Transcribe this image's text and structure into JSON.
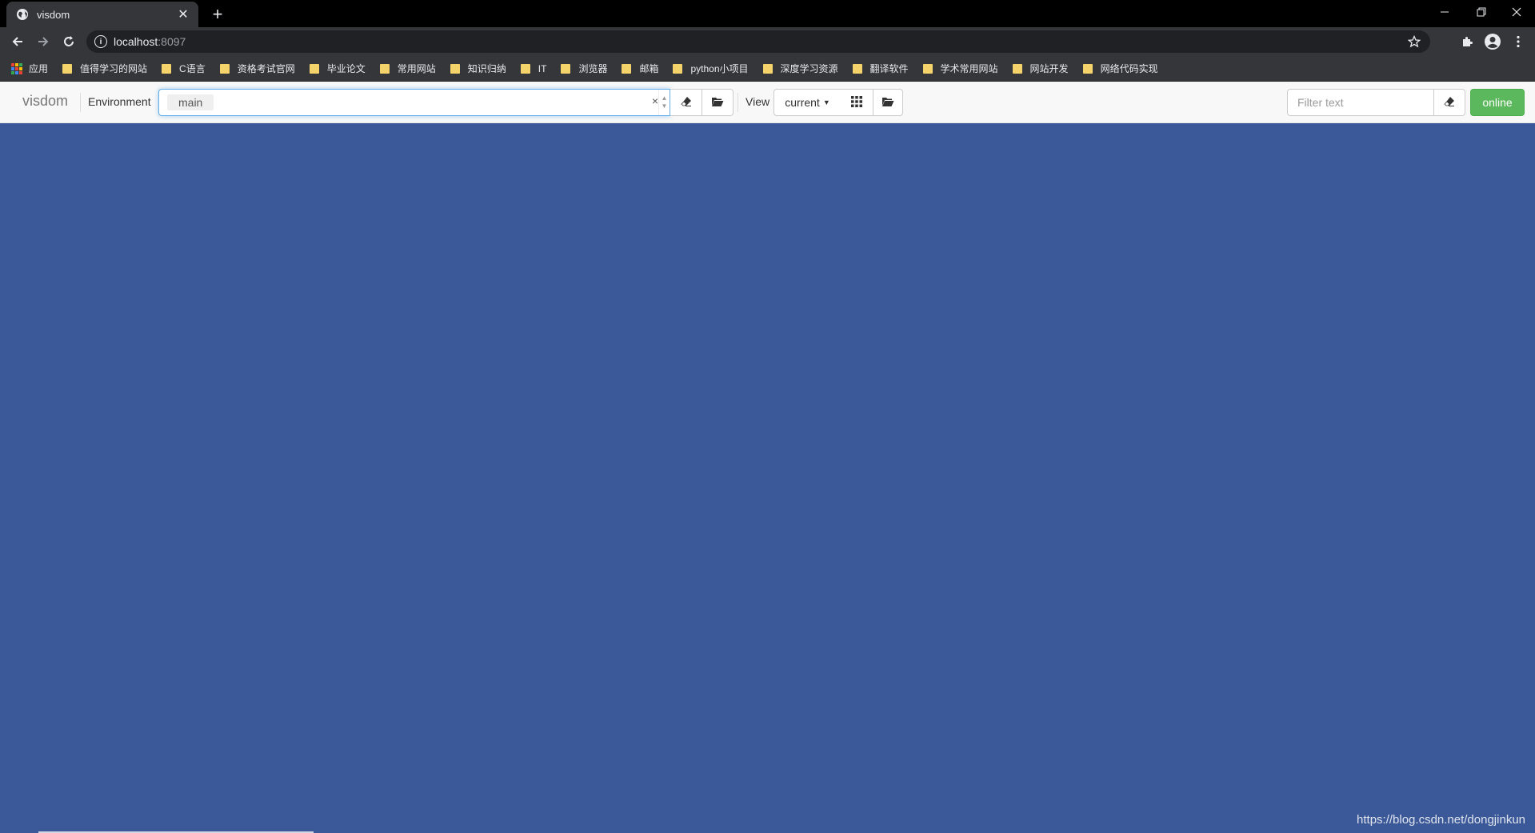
{
  "browser": {
    "tab": {
      "title": "visdom",
      "favicon": "globe-icon"
    },
    "new_tab_label": "+",
    "address": {
      "host": "localhost",
      "port": ":8097"
    },
    "window_controls": [
      "minimize-icon",
      "restore-icon",
      "close-icon"
    ]
  },
  "bookmarks": {
    "apps_label": "应用",
    "items": [
      "值得学习的网站",
      "C语言",
      "资格考试官网",
      "毕业论文",
      "常用网站",
      "知识归纳",
      "IT",
      "浏览器",
      "邮箱",
      "python小项目",
      "深度学习资源",
      "翻译软件",
      "学术常用网站",
      "网站开发",
      "网络代码实现"
    ]
  },
  "visdom": {
    "brand": "visdom",
    "environment_label": "Environment",
    "environment_selected": "main",
    "environment_clear": "×",
    "view_label": "View",
    "view_selected": "current",
    "filter_placeholder": "Filter text",
    "status_label": "online"
  },
  "colors": {
    "content_background": "#3b5998",
    "online_green": "#5cb85c",
    "focus_blue": "#66afe9"
  },
  "watermark": "https://blog.csdn.net/dongjinkun"
}
